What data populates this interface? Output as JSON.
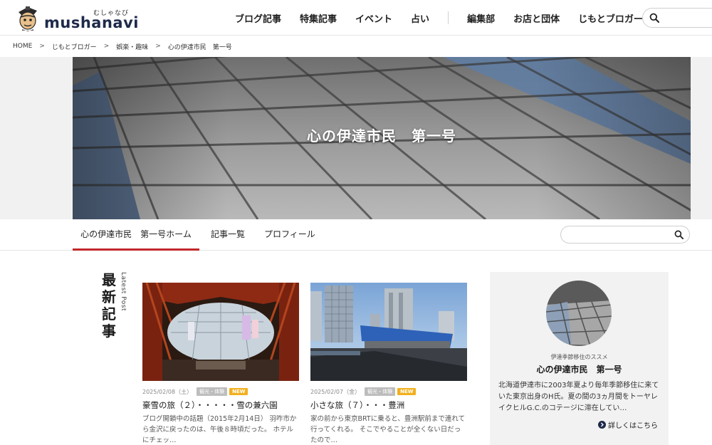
{
  "site": {
    "logo_kana": "むしゃなび",
    "logo_word": "mushanavi"
  },
  "nav": {
    "items": [
      "ブログ記事",
      "特集記事",
      "イベント",
      "占い"
    ],
    "items_right": [
      "編集部",
      "お店と団体",
      "じもとブロガー"
    ]
  },
  "header_search": {
    "placeholder": ""
  },
  "breadcrumb": [
    "HOME",
    "じもとブロガー",
    "娯楽・趣味",
    "心の伊達市民　第一号"
  ],
  "hero": {
    "title": "心の伊達市民　第一号"
  },
  "subnav": {
    "tabs": [
      "心の伊達市民　第一号ホーム",
      "記事一覧",
      "プロフィール"
    ],
    "active_index": 0,
    "search_placeholder": ""
  },
  "latest": {
    "title": "最新記事",
    "subtitle": "Latest Post",
    "posts": [
      {
        "date": "2025/02/08（土）",
        "category": "観光・体験",
        "badge": "NEW",
        "title": "豪雪の旅（２）・・・・・雪の兼六園",
        "excerpt": "ブログ開鎖中の話題（2015年2月14日） 羽咋市から金沢に戻ったのは、午後８時頃だった。 ホテルにチェッ…"
      },
      {
        "date": "2025/02/07（金）",
        "category": "観光・体験",
        "badge": "NEW",
        "title": "小さな旅（７）・・・豊洲",
        "excerpt": "家の前から東京BRTに乗ると、豊洲駅前まで連れて行ってくれる。 そこでやることが全くない日だったので…"
      }
    ]
  },
  "profile": {
    "tagline": "伊達季節移住のススメ",
    "name": "心の伊達市民　第一号",
    "bio": "北海道伊達市に2003年夏より毎年季節移住に来ていた東京出身のH氏。夏の間の3ヵ月間をトーヤレイクヒルG.C.のコテージに滞在してい…",
    "more_label": "詳しくはこちら"
  },
  "colors": {
    "accent": "#c1272d",
    "new_badge": "#f2b01e",
    "category_badge": "#bdbdbd",
    "logo_text": "#1e2a4a"
  }
}
